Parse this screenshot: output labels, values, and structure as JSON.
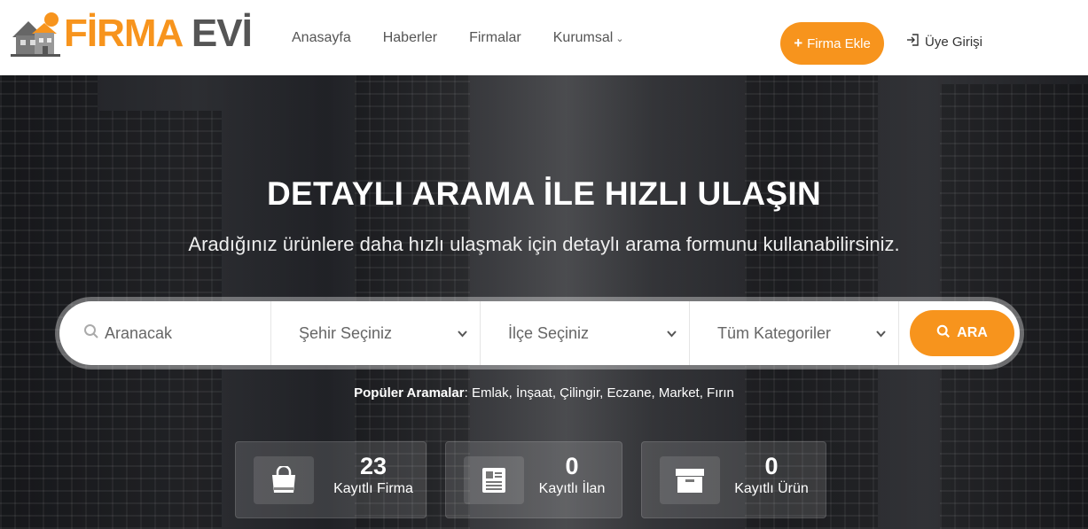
{
  "brand": {
    "name_part1": "FİRMA",
    "name_part2": "EVİ"
  },
  "nav": {
    "items": [
      "Anasayfa",
      "Haberler",
      "Firmalar",
      "Kurumsal"
    ]
  },
  "header": {
    "add_firm_label": "Firma Ekle",
    "login_label": "Üye Girişi"
  },
  "hero": {
    "title": "DETAYLI ARAMA İLE HIZLI ULAŞIN",
    "subtitle": "Aradığınız ürünlere daha hızlı ulaşmak için detaylı arama formunu kullanabilirsiniz."
  },
  "search": {
    "query_placeholder": "Aranacak",
    "city_label": "Şehir Seçiniz",
    "district_label": "İlçe Seçiniz",
    "category_label": "Tüm Kategoriler",
    "button_label": "ARA"
  },
  "popular": {
    "label": "Popüler Aramalar",
    "terms": "Emlak, İnşaat, Çilingir, Eczane, Market, Fırın"
  },
  "stats": [
    {
      "value": "23",
      "label": "Kayıtlı Firma",
      "icon": "shopping-bag-icon"
    },
    {
      "value": "0",
      "label": "Kayıtlı İlan",
      "icon": "newspaper-icon"
    },
    {
      "value": "0",
      "label": "Kayıtlı Ürün",
      "icon": "archive-box-icon"
    }
  ],
  "colors": {
    "accent": "#f7941d"
  }
}
